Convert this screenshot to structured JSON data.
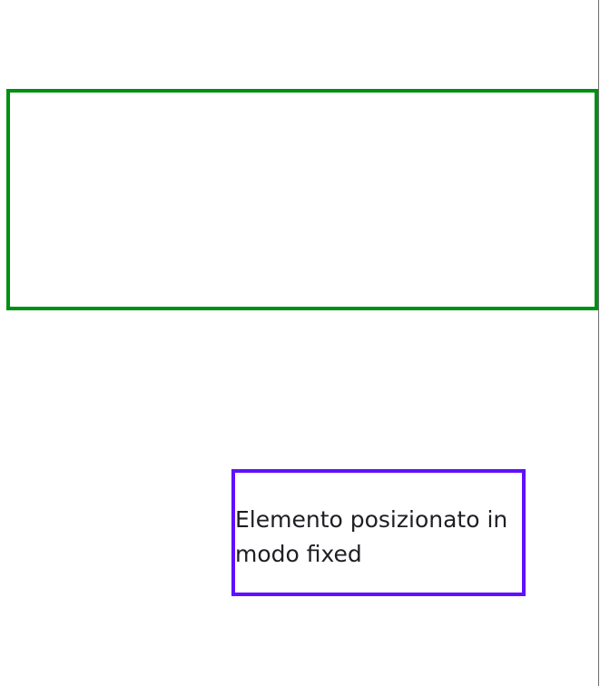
{
  "fixed_element": {
    "text": "Elemento posizionato in modo fixed"
  },
  "colors": {
    "green_border": "#008f11",
    "purple_border": "#6010ff",
    "text": "#1e1e24",
    "background": "#ffffff"
  }
}
